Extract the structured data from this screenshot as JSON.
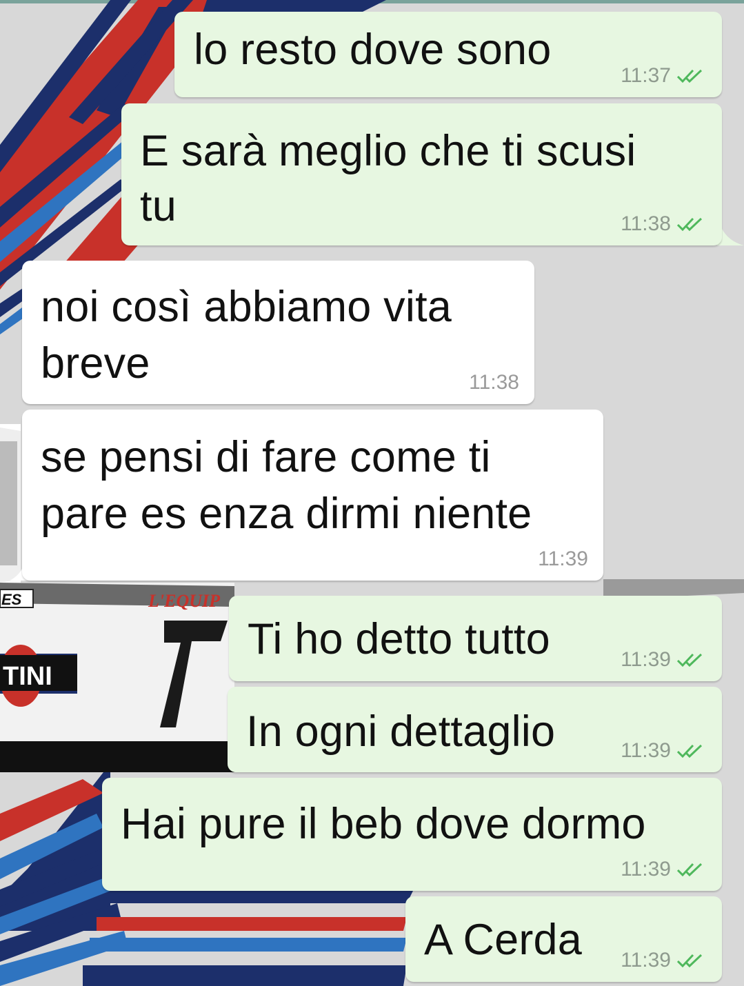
{
  "wallpaper": {
    "car_badge_text": "ES",
    "car_sponsor_text": "TINI",
    "car_team_text": "L'EQUIP",
    "car_number": "7"
  },
  "messages": [
    {
      "direction": "outgoing",
      "text": "lo resto dove sono",
      "time": "11:37",
      "status": "read"
    },
    {
      "direction": "outgoing",
      "lines": [
        "E sarà meglio che ti scusi",
        "tu"
      ],
      "time": "11:38",
      "status": "read"
    },
    {
      "direction": "incoming",
      "lines": [
        "noi così abbiamo vita",
        "breve"
      ],
      "time": "11:38"
    },
    {
      "direction": "incoming",
      "lines": [
        "se pensi di fare come ti",
        "pare es enza dirmi niente"
      ],
      "time": "11:39"
    },
    {
      "direction": "outgoing",
      "text": "Ti ho detto tutto",
      "time": "11:39",
      "status": "read"
    },
    {
      "direction": "outgoing",
      "text": "In ogni dettaglio",
      "time": "11:39",
      "status": "read"
    },
    {
      "direction": "outgoing",
      "text": "Hai pure il beb dove dormo",
      "time": "11:39",
      "status": "read"
    },
    {
      "direction": "outgoing",
      "text": "A Cerda",
      "time": "11:39",
      "status": "read"
    }
  ],
  "colors": {
    "outgoing_bubble": "#e7f7e1",
    "incoming_bubble": "#ffffff",
    "read_tick": "#4fb85c"
  }
}
